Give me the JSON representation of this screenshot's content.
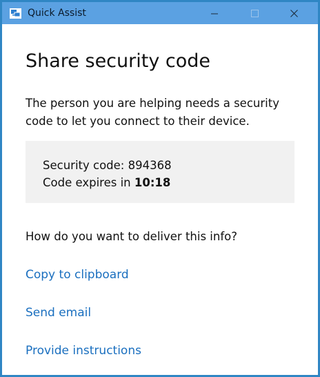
{
  "window": {
    "title": "Quick Assist",
    "icons": {
      "app": "quick-assist-icon",
      "minimize": "minimize-icon",
      "maximize": "maximize-icon",
      "close": "close-icon"
    }
  },
  "main": {
    "title": "Share security code",
    "description": "The person you are helping needs a security code to let you connect to their device.",
    "code_box": {
      "security_code_label": "Security code: ",
      "security_code": "894368",
      "expires_label": "Code expires in ",
      "expires_time": "10:18"
    },
    "question": "How do you want to deliver this info?",
    "options": [
      {
        "label": "Copy to clipboard"
      },
      {
        "label": "Send email"
      },
      {
        "label": "Provide instructions"
      }
    ]
  },
  "colors": {
    "titlebar": "#5ba1e2",
    "border": "#2f86c4",
    "link": "#1a6fbf",
    "code_box_bg": "#f1f1f1"
  }
}
